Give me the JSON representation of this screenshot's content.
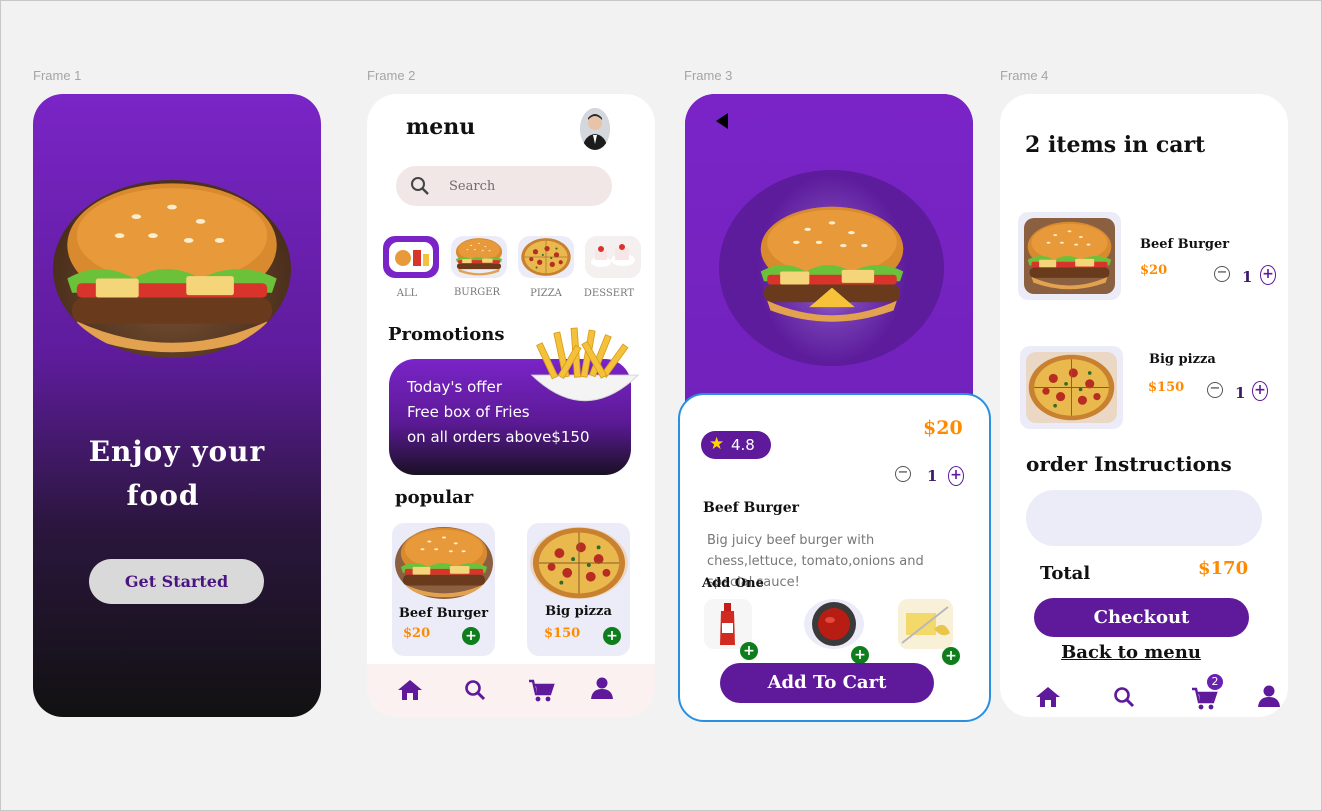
{
  "frame_labels": [
    "Frame 1",
    "Frame 2",
    "Frame 3",
    "Frame 4"
  ],
  "colors": {
    "primary": "#5e1a9a",
    "accent_purple": "#7a24c8",
    "price_orange": "#ff8a00",
    "add_green": "#0e7d1c",
    "card_lavender": "#ececf8"
  },
  "frame1": {
    "title_line1": "Enjoy  your",
    "title_line2": "food",
    "cta": "Get Started"
  },
  "frame2": {
    "title": "menu",
    "search_placeholder": "Search",
    "categories": [
      {
        "label": "ALL",
        "active": true
      },
      {
        "label": "BURGER",
        "active": false
      },
      {
        "label": "PIZZA",
        "active": false
      },
      {
        "label": "DESSERT",
        "active": false
      }
    ],
    "promotions_heading": "Promotions",
    "promo_lines": [
      "Today's offer",
      "Free box of Fries",
      "on all orders above$150"
    ],
    "popular_heading": "popular",
    "popular": [
      {
        "name": "Beef Burger",
        "price": "$20"
      },
      {
        "name": "Big pizza",
        "price": "$150"
      }
    ],
    "nav": [
      "home-icon",
      "search-icon",
      "cart-icon",
      "profile-icon"
    ]
  },
  "frame3": {
    "price": "$20",
    "rating": "4.8",
    "quantity": "1",
    "name": "Beef Burger",
    "description": "Big juicy beef burger with chess,lettuce, tomato,onions and special sauce!",
    "add_one_label": "Add One",
    "addons": [
      "ketchup-bottle",
      "ketchup-dip",
      "butter"
    ],
    "cta": "Add To Cart"
  },
  "frame4": {
    "title": "2  items in cart",
    "items": [
      {
        "name": "Beef Burger",
        "price": "$20",
        "quantity": "1"
      },
      {
        "name": "Big pizza",
        "price": "$150",
        "quantity": "1"
      }
    ],
    "instructions_heading": "order Instructions",
    "total_label": "Total",
    "total_value": "$170",
    "checkout": "Checkout",
    "back": "Back to menu",
    "cart_badge": "2"
  }
}
